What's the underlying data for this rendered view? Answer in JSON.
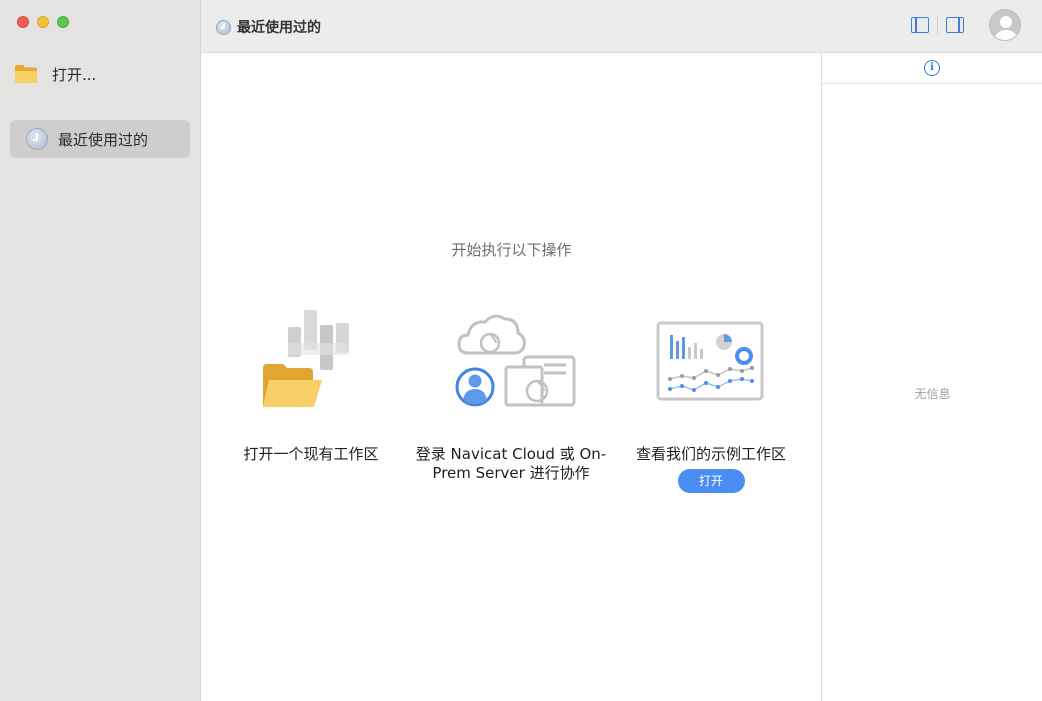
{
  "sidebar": {
    "open_label": "打开...",
    "recent_label": "最近使用过的"
  },
  "topbar": {
    "title": "最近使用过的"
  },
  "main": {
    "prompt": "开始执行以下操作",
    "actions": [
      {
        "caption": "打开一个现有工作区",
        "icon": "open-folder-workspace-icon"
      },
      {
        "caption": "登录 Navicat Cloud 或 On-Prem Server 进行协作",
        "icon": "cloud-collaboration-icon"
      },
      {
        "caption": "查看我们的示例工作区",
        "icon": "sample-dashboard-icon",
        "button": "打开"
      }
    ]
  },
  "info_panel": {
    "empty_text": "无信息"
  },
  "colors": {
    "accent": "#4a8ef3",
    "sidebar_bg": "#e4e3e2",
    "selected_bg": "#cfcecd"
  }
}
